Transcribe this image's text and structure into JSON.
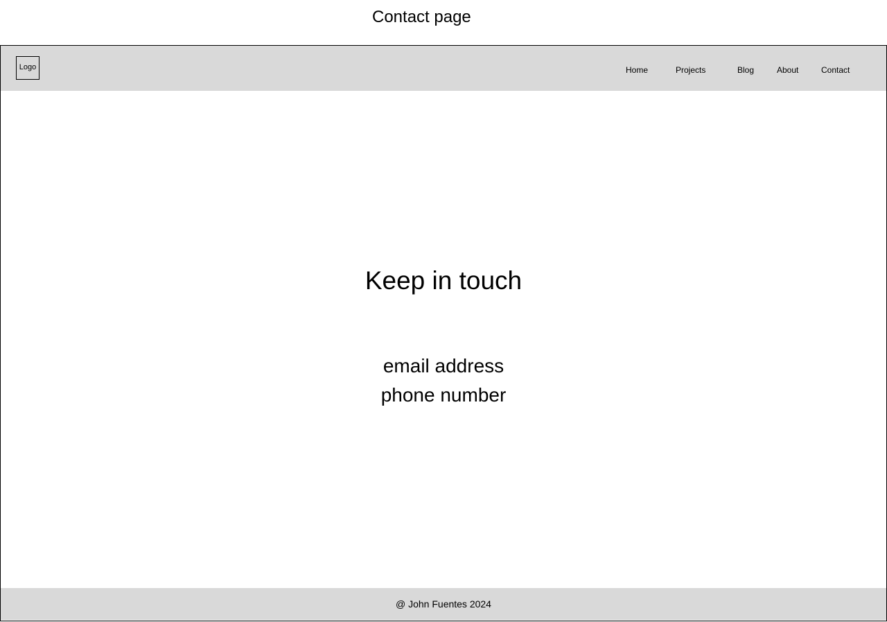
{
  "page_label": "Contact page",
  "header": {
    "logo_label": "Logo",
    "nav": {
      "home": "Home",
      "projects": "Projects",
      "blog": "Blog",
      "about": "About",
      "contact": "Contact"
    },
    "background_color": "#d9d9d9"
  },
  "main": {
    "heading": "Keep in touch",
    "email_label": "email address",
    "phone_label": "phone number"
  },
  "footer": {
    "copyright": "@ John Fuentes 2024",
    "background_color": "#d9d9d9"
  }
}
